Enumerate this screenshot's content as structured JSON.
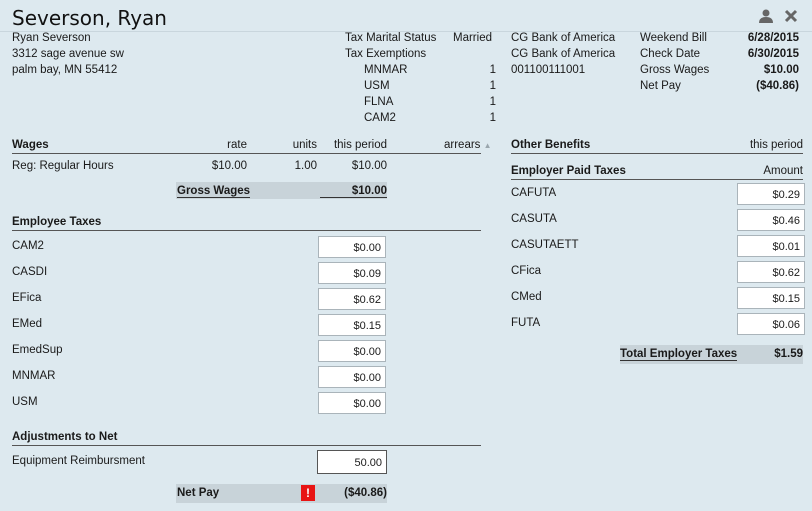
{
  "employee": {
    "name": "Severson, Ryan",
    "address1": "Ryan  Severson",
    "address2": "3312 sage avenue sw",
    "address3": "palm bay, MN  55412"
  },
  "tax_info": {
    "marital_label": "Tax Marital Status",
    "marital_value": "Married",
    "exemptions_label": "Tax Exemptions",
    "exemptions": [
      {
        "name": "MNMAR",
        "value": "1"
      },
      {
        "name": "USM",
        "value": "1"
      },
      {
        "name": "FLNA",
        "value": "1"
      },
      {
        "name": "CAM2",
        "value": "1"
      }
    ]
  },
  "bank": {
    "line1": "CG Bank of America",
    "line2": "CG Bank of America",
    "line3": "001100111001"
  },
  "summary": [
    {
      "label": "Weekend Bill",
      "value": "6/28/2015"
    },
    {
      "label": "Check Date",
      "value": "6/30/2015"
    },
    {
      "label": "Gross Wages",
      "value": "$10.00"
    },
    {
      "label": "Net Pay",
      "value": "($40.86)"
    }
  ],
  "wages": {
    "title": "Wages",
    "col_rate": "rate",
    "col_units": "units",
    "col_period": "this period",
    "col_arrears": "arrears",
    "rows": [
      {
        "name": "Reg: Regular Hours",
        "rate": "$10.00",
        "units": "1.00",
        "period": "$10.00"
      }
    ],
    "gross_label": "Gross Wages",
    "gross_value": "$10.00"
  },
  "employee_taxes": {
    "title": "Employee Taxes",
    "rows": [
      {
        "name": "CAM2",
        "value": "$0.00"
      },
      {
        "name": "CASDI",
        "value": "$0.09"
      },
      {
        "name": "EFica",
        "value": "$0.62"
      },
      {
        "name": "EMed",
        "value": "$0.15"
      },
      {
        "name": "EmedSup",
        "value": "$0.00"
      },
      {
        "name": "MNMAR",
        "value": "$0.00"
      },
      {
        "name": "USM",
        "value": "$0.00"
      }
    ]
  },
  "adjustments": {
    "title": "Adjustments to Net",
    "rows": [
      {
        "name": "Equipment Reimbursment",
        "value": "50.00"
      }
    ]
  },
  "net_pay": {
    "label": "Net Pay",
    "warning": "!",
    "value": "($40.86)"
  },
  "other_benefits": {
    "title": "Other Benefits",
    "col_period": "this period"
  },
  "employer_taxes": {
    "title": "Employer Paid Taxes",
    "col_amount": "Amount",
    "rows": [
      {
        "name": "CAFUTA",
        "value": "$0.29"
      },
      {
        "name": "CASUTA",
        "value": "$0.46"
      },
      {
        "name": "CASUTAETT",
        "value": "$0.01"
      },
      {
        "name": "CFica",
        "value": "$0.62"
      },
      {
        "name": "CMed",
        "value": "$0.15"
      },
      {
        "name": "FUTA",
        "value": "$0.06"
      }
    ],
    "total_label": "Total Employer Taxes",
    "total_value": "$1.59"
  },
  "colors": {
    "background": "#dde9ef",
    "warning": "#e81414"
  },
  "icons": [
    "user-icon",
    "close-icon"
  ]
}
